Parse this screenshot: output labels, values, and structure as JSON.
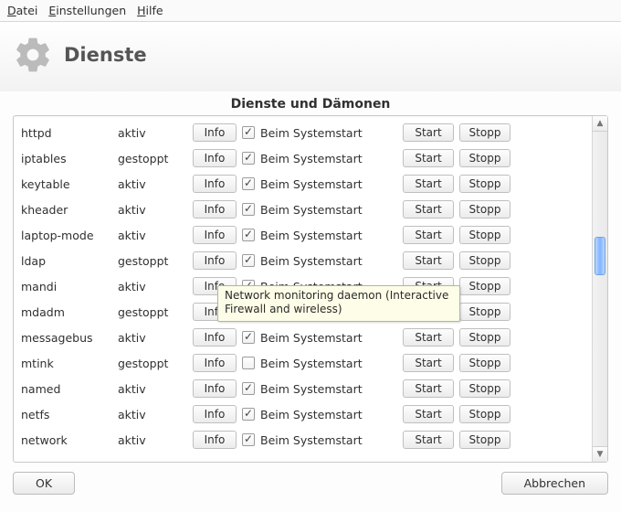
{
  "menu": {
    "file_prefix": "D",
    "file_rest": "atei",
    "settings_prefix": "E",
    "settings_rest": "instellungen",
    "help_prefix": "H",
    "help_rest": "ilfe"
  },
  "header": {
    "title": "Dienste"
  },
  "section_title": "Dienste und Dämonen",
  "labels": {
    "info": "Info",
    "boot": "Beim Systemstart",
    "start": "Start",
    "stop": "Stopp",
    "ok": "OK",
    "cancel": "Abbrechen"
  },
  "tooltip": "Network monitoring daemon (Interactive Firewall and wireless)",
  "services": [
    {
      "name": "httpd",
      "status": "aktiv",
      "boot": true
    },
    {
      "name": "iptables",
      "status": "gestoppt",
      "boot": true
    },
    {
      "name": "keytable",
      "status": "aktiv",
      "boot": true
    },
    {
      "name": "kheader",
      "status": "aktiv",
      "boot": true
    },
    {
      "name": "laptop-mode",
      "status": "aktiv",
      "boot": true
    },
    {
      "name": "ldap",
      "status": "gestoppt",
      "boot": true
    },
    {
      "name": "mandi",
      "status": "aktiv",
      "boot": true
    },
    {
      "name": "mdadm",
      "status": "gestoppt",
      "boot": true
    },
    {
      "name": "messagebus",
      "status": "aktiv",
      "boot": true
    },
    {
      "name": "mtink",
      "status": "gestoppt",
      "boot": false
    },
    {
      "name": "named",
      "status": "aktiv",
      "boot": true
    },
    {
      "name": "netfs",
      "status": "aktiv",
      "boot": true
    },
    {
      "name": "network",
      "status": "aktiv",
      "boot": true
    }
  ]
}
